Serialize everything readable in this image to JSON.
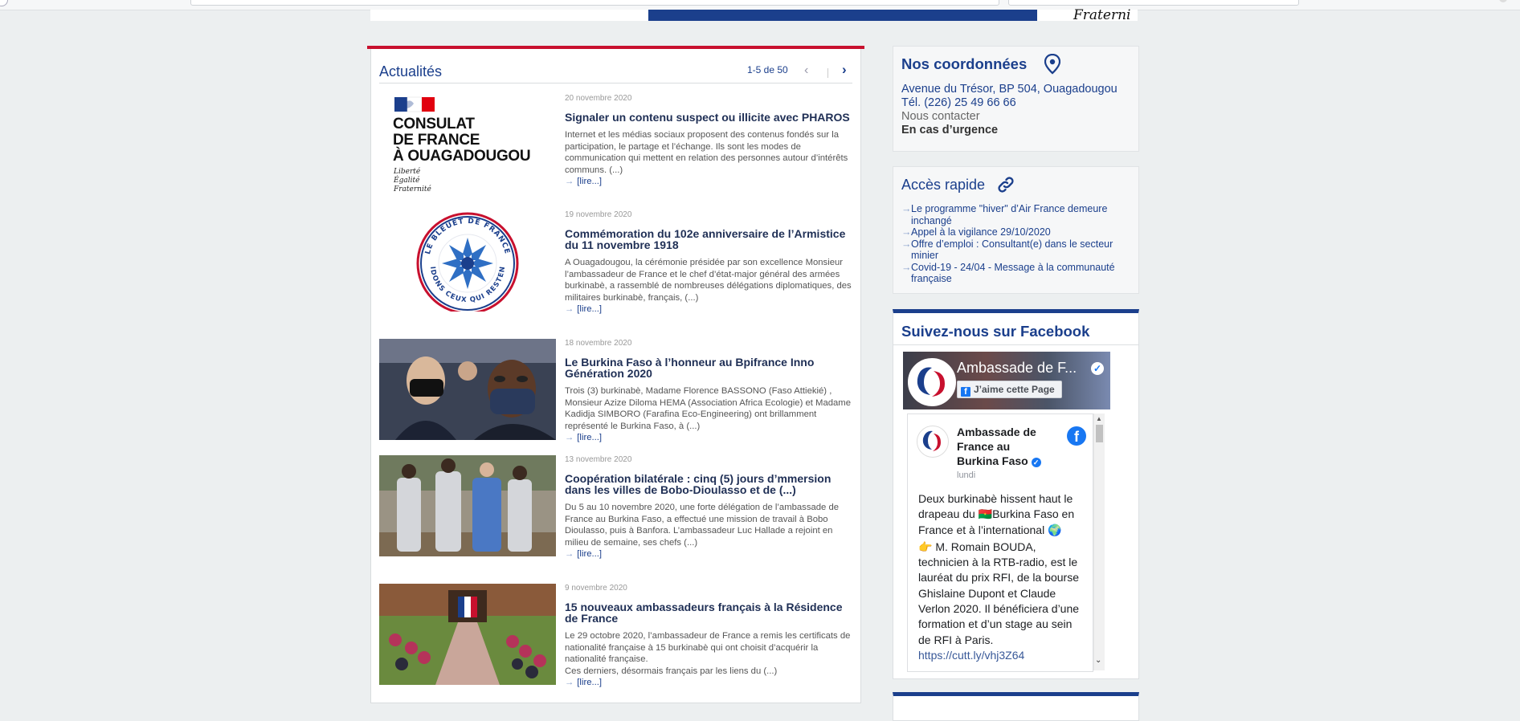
{
  "header": {
    "motto": "Fraterni"
  },
  "news": {
    "title": "Actualités",
    "pager": "1-5 de 50",
    "prev_symbol": "‹",
    "next_symbol": "›",
    "articles": [
      {
        "date": "20 novembre 2020",
        "title": "Signaler un contenu suspect ou illicite avec PHAROS",
        "text": "Internet et les médias sociaux proposent des contenus fondés sur la participation, le partage et l’échange. Ils sont les modes de communication qui mettent en relation des personnes autour d’intérêts communs. (...)",
        "more": "[lire...]",
        "thumb": {
          "line1": "CONSULAT",
          "line2": "DE FRANCE",
          "line3": "À OUAGADOUGOU",
          "m1": "Liberté",
          "m2": "Égalité",
          "m3": "Fraternité"
        }
      },
      {
        "date": "19 novembre 2020",
        "title": "Commémoration du 102e anniversaire de l’Armistice du 11 novembre 1918",
        "text": "A Ouagadougou, la cérémonie présidée par son excellence Monsieur l’ambassadeur de France et le chef d’état-major général des armées burkinabè, a rassemblé de nombreuses délégations diplomatiques, des militaires burkinabè, français, (...)",
        "more": "[lire...]",
        "thumb": {
          "top_text": "LE BLEUET DE FRANCE",
          "bottom_text": "AIDONS CEUX QUI RESTENT"
        }
      },
      {
        "date": "18 novembre 2020",
        "title": "Le Burkina Faso à l’honneur au Bpifrance Inno Génération 2020",
        "text": "Trois (3) burkinabè, Madame Florence BASSONO (Faso Attiekié) , Monsieur Azize Diloma HEMA (Association Africa Ecologie) et Madame Kadidja SIMBORO (Farafina Eco-Engineering) ont brillamment représenté le Burkina Faso, à (...)",
        "more": "[lire...]"
      },
      {
        "date": "13 novembre 2020",
        "title": "Coopération bilatérale : cinq (5) jours d’mmersion dans les villes de Bobo-Dioulasso et de (...)",
        "text": "Du 5 au 10 novembre 2020, une forte délégation de l’ambassade de France au Burkina Faso, a effectué une mission de travail à Bobo Dioulasso, puis à Banfora. L’ambassadeur Luc Hallade a rejoint en milieu de semaine, ses chefs (...)",
        "more": "[lire...]"
      },
      {
        "date": "9 novembre 2020",
        "title": "15 nouveaux ambassadeurs français à la Résidence de France",
        "text": "Le 29 octobre 2020, l’ambassadeur de France a remis les certificats de nationalité française à 15 burkinabè qui ont choisit d’acquérir la nationalité française.\nCes derniers, désormais français par les liens du (...)",
        "more": "[lire...]"
      }
    ]
  },
  "contact": {
    "title": "Nos coordonnées",
    "address": "Avenue du Trésor, BP 504, Ouagadougou",
    "phone": "Tél. (226) 25 49 66 66",
    "contact_us": "Nous contacter",
    "emergency": "En cas d’urgence",
    "icon": "map-pin-icon"
  },
  "quick_access": {
    "title": "Accès rapide",
    "icon": "link-icon",
    "items": [
      "Le programme \"hiver\" d’Air France demeure inchangé",
      "Appel à la vigilance 29/10/2020",
      "Offre d’emploi : Consultant(e) dans le secteur minier",
      "Covid-19 - 24/04 - Message à la communauté française"
    ]
  },
  "facebook": {
    "title": "Suivez-nous sur Facebook",
    "page_name": "Ambassade de F...",
    "like_label": "J’aime cette Page",
    "post_author": "Ambassade de France au Burkina Faso",
    "post_time": "lundi",
    "post_text_1": "Deux burkinabè hissent haut le drapeau du 🇧🇫Burkina Faso en France et à l’international 🌍",
    "post_text_2": "👉 M. Romain BOUDA, technicien à la RTB-radio, est le lauréat du prix RFI, de la bourse Ghislaine Dupont et Claude Verlon 2020. Il bénéficiera d’une formation et d’un stage au sein de RFI à Paris.",
    "post_link": "https://cutt.ly/vhj3Z64"
  },
  "colors": {
    "brand_blue": "#1b3f8c",
    "accent_red": "#c8102e",
    "facebook_blue": "#1877f2"
  }
}
